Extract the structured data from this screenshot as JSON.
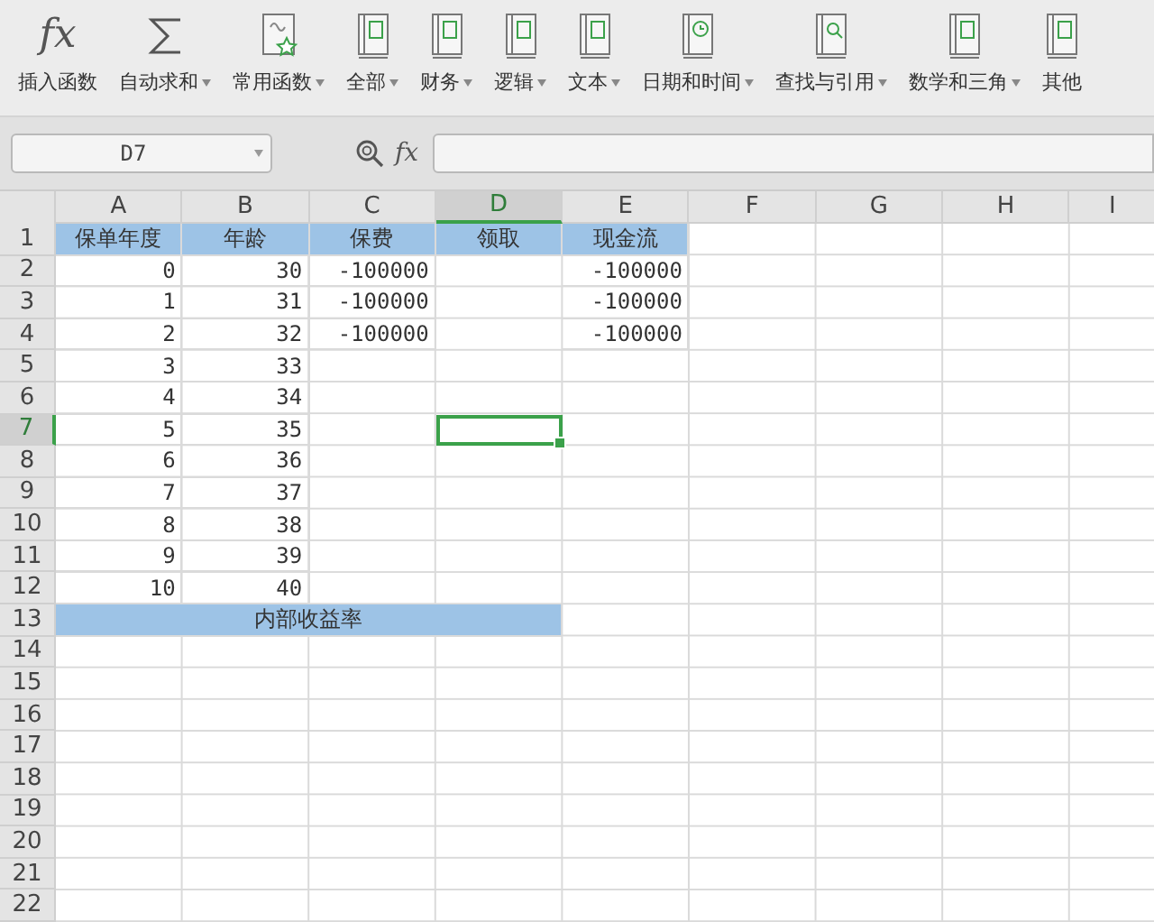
{
  "ribbon": {
    "items": [
      {
        "label": "插入函数",
        "kind": "fx",
        "glyph": "fx",
        "dropdown": false
      },
      {
        "label": "自动求和",
        "kind": "sigma",
        "dropdown": true
      },
      {
        "label": "常用函数",
        "kind": "star-book",
        "dropdown": true
      },
      {
        "label": "全部",
        "kind": "book",
        "dropdown": true
      },
      {
        "label": "财务",
        "kind": "book",
        "dropdown": true
      },
      {
        "label": "逻辑",
        "kind": "book",
        "dropdown": true
      },
      {
        "label": "文本",
        "kind": "book",
        "dropdown": true
      },
      {
        "label": "日期和时间",
        "kind": "clock-book",
        "dropdown": true
      },
      {
        "label": "查找与引用",
        "kind": "search-book",
        "dropdown": true
      },
      {
        "label": "数学和三角",
        "kind": "book",
        "dropdown": true
      },
      {
        "label": "其他",
        "kind": "book",
        "dropdown": false
      }
    ]
  },
  "formula_bar": {
    "name_box": "D7",
    "fx": "fx"
  },
  "columns": [
    {
      "label": "A",
      "selected": false
    },
    {
      "label": "B",
      "selected": false
    },
    {
      "label": "C",
      "selected": false
    },
    {
      "label": "D",
      "selected": true
    },
    {
      "label": "E",
      "selected": false
    },
    {
      "label": "F",
      "selected": false
    },
    {
      "label": "G",
      "selected": false
    },
    {
      "label": "H",
      "selected": false
    },
    {
      "label": "I",
      "selected": false
    }
  ],
  "rows": [
    {
      "label": "1",
      "selected": false,
      "highlighted": true,
      "kind": "header",
      "cells": [
        "保单年度",
        "年龄",
        "保费",
        "领取",
        "现金流"
      ]
    },
    {
      "label": "2",
      "selected": false,
      "highlighted": false,
      "kind": "data",
      "cells": [
        "0",
        "30",
        "-100000",
        null,
        "-100000"
      ]
    },
    {
      "label": "3",
      "selected": false,
      "highlighted": false,
      "kind": "data",
      "cells": [
        "1",
        "31",
        "-100000",
        null,
        "-100000"
      ]
    },
    {
      "label": "4",
      "selected": false,
      "highlighted": false,
      "kind": "data",
      "cells": [
        "2",
        "32",
        "-100000",
        null,
        "-100000"
      ]
    },
    {
      "label": "5",
      "selected": false,
      "highlighted": false,
      "kind": "data",
      "cells": [
        "3",
        "33"
      ]
    },
    {
      "label": "6",
      "selected": false,
      "highlighted": false,
      "kind": "data",
      "cells": [
        "4",
        "34"
      ]
    },
    {
      "label": "7",
      "selected": true,
      "highlighted": false,
      "kind": "data",
      "cells": [
        "5",
        "35"
      ]
    },
    {
      "label": "8",
      "selected": false,
      "highlighted": false,
      "kind": "data",
      "cells": [
        "6",
        "36"
      ]
    },
    {
      "label": "9",
      "selected": false,
      "highlighted": false,
      "kind": "data",
      "cells": [
        "7",
        "37"
      ]
    },
    {
      "label": "10",
      "selected": false,
      "highlighted": false,
      "kind": "data",
      "cells": [
        "8",
        "38"
      ]
    },
    {
      "label": "11",
      "selected": false,
      "highlighted": false,
      "kind": "data",
      "cells": [
        "9",
        "39"
      ]
    },
    {
      "label": "12",
      "selected": false,
      "highlighted": false,
      "kind": "data",
      "cells": [
        "10",
        "40"
      ]
    },
    {
      "label": "13",
      "selected": false,
      "highlighted": true,
      "kind": "merged",
      "text": "内部收益率"
    },
    {
      "label": "14",
      "selected": false
    },
    {
      "label": "15",
      "selected": false
    },
    {
      "label": "16",
      "selected": false
    },
    {
      "label": "17",
      "selected": false
    },
    {
      "label": "18",
      "selected": false
    },
    {
      "label": "19",
      "selected": false
    },
    {
      "label": "20",
      "selected": false
    },
    {
      "label": "21",
      "selected": false
    },
    {
      "label": "22",
      "selected": false
    }
  ]
}
